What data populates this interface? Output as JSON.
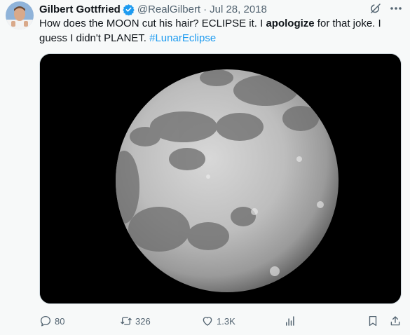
{
  "tweet": {
    "author_name": "Gilbert Gottfried",
    "handle": "@RealGilbert",
    "separator": "·",
    "date": "Jul 28, 2018",
    "text_parts": [
      "How does the MOON cut his hair?  ECLIPSE it.  I ",
      "apologize",
      " for that joke.  I guess I didn't PLANET.  ",
      "#LunarEclipse"
    ],
    "image_icon": "full-moon-photo"
  },
  "actions": {
    "replies": "80",
    "reposts": "326",
    "likes": "1.3K"
  },
  "icons": {
    "verified": "verified-badge-icon",
    "grok": "grok-icon",
    "more": "more-icon",
    "reply": "reply-icon",
    "repost": "repost-icon",
    "like": "heart-icon",
    "views": "views-icon",
    "bookmark": "bookmark-icon",
    "share": "share-icon"
  },
  "colors": {
    "accent": "#1d9bf0",
    "muted": "#536471",
    "background": "#f7f9f9"
  }
}
